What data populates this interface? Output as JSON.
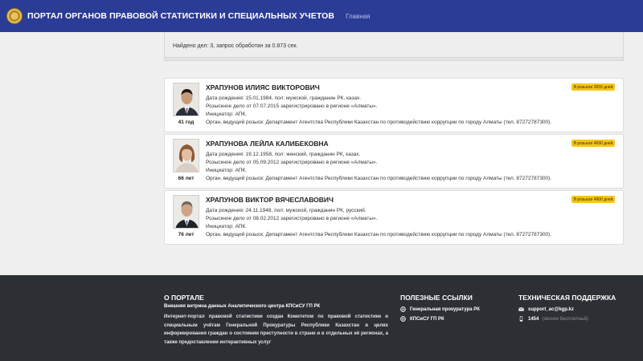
{
  "header": {
    "title": "ПОРТАЛ ОРГАНОВ ПРАВОВОЙ СТАТИСТИКИ И СПЕЦИАЛЬНЫХ УЧЕТОВ",
    "home": "Главная"
  },
  "search": {
    "found_text": "Найдено дел: 3, запрос обработан за 0.873 сек."
  },
  "results": [
    {
      "name": "ХРАПУНОВ ИЛИЯС ВИКТОРОВИЧ",
      "badge": "В розыске 3655 дней",
      "birth": "Дата рождения: 15.01.1984, пол: мужской, гражданин РК, казах.",
      "case": "Розыскное дело от 07.07.2015 зарегистрировано в регионе «Алматы».",
      "initiator": "Инициатор: АПК.",
      "organ": "Орган, ведущий розыск: Департамент Агентства Республики Казахстан по противодействию коррупции по городу Алматы (тел. 87272787300).",
      "age": "41 год"
    },
    {
      "name": "ХРАПУНОВА ЛЕЙЛА КАЛИБЕКОВНА",
      "badge": "В розыске 4690 дней",
      "birth": "Дата рождения: 19.12.1958, пол: женский, гражданин РК, казах.",
      "case": "Розыскное дело от 05.09.2012 зарегистрировано в регионе «Алматы».",
      "initiator": "Инициатор: АПК.",
      "organ": "Орган, ведущий розыск: Департамент Агентства Республики Казахстан по противодействию коррупции по городу Алматы (тел. 87272787300).",
      "age": "66 лет"
    },
    {
      "name": "ХРАПУНОВ ВИКТОР ВЯЧЕСЛАВОВИЧ",
      "badge": "В розыске 4900 дней",
      "birth": "Дата рождения: 24.11.1948, пол: мужской, гражданин РК, русский.",
      "case": "Розыскное дело от 08.02.2012 зарегистрировано в регионе «Алматы».",
      "initiator": "Инициатор: АПК.",
      "organ": "Орган, ведущий розыск: Департамент Агентства Республики Казахстан по противодействию коррупции по городу Алматы (тел. 87272787300).",
      "age": "76 лет"
    }
  ],
  "footer": {
    "about_title": "О ПОРТАЛЕ",
    "about_subtitle": "Внешняя витрина данных Аналитического центра КПСиСУ ГП РК",
    "about_text": "Интернет-портал правовой статистики создан Комитетом по правовой статистике и специальным учётам Генеральной Прокуратуры Республики Казахстан в целях информирования граждан о состоянии преступности в стране и в отдельных её регионах, а также предоставлении интерактивных услуг",
    "links_title": "ПОЛЕЗНЫЕ ССЫЛКИ",
    "links": [
      "Генеральная прокуратура РК",
      "КПСиСУ ГП РК"
    ],
    "support_title": "ТЕХНИЧЕСКАЯ ПОДДЕРЖКА",
    "email": "support_ac@kgp.kz",
    "phone": "1454",
    "phone_note": "(звонок бесплатный)"
  },
  "colors": {
    "navbar": "#2b3c96",
    "badge": "#f5c518",
    "footer": "#2c2f33"
  },
  "icons": [
    "emblem-logo",
    "globe-icon",
    "envelope-icon",
    "phone-icon"
  ]
}
